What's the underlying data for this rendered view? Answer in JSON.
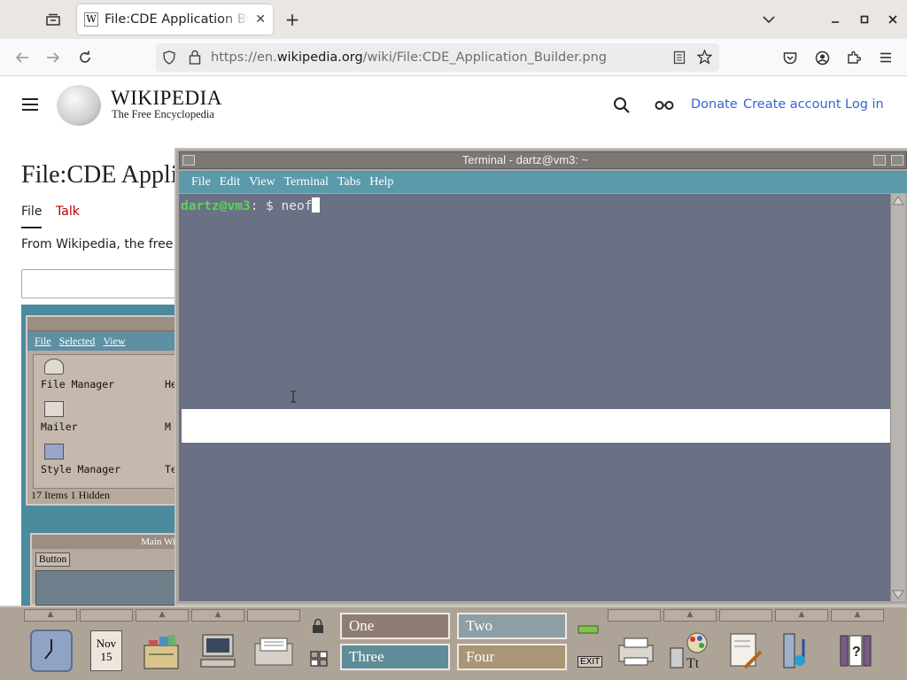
{
  "browser": {
    "tab_title": "File:CDE Application Builder.png",
    "tab_favicon": "W",
    "tab_close": "✕",
    "new_tab": "+",
    "url_prefix": "https://en.",
    "url_domain": "wikipedia.org",
    "url_path": "/wiki/File:CDE_Application_Builder.png"
  },
  "wikipedia": {
    "wordmark": "WIKIPEDIA",
    "tagline": "The Free Encyclopedia",
    "donate": "Donate",
    "create_account": "Create account",
    "log_in": "Log in",
    "page_title": "File:CDE Application Builder.png",
    "tab_file": "File",
    "tab_talk": "Talk",
    "from_text": "From Wikipedia, the free encyclopedia"
  },
  "cde_image": {
    "fm_menu": [
      "File",
      "Selected",
      "View"
    ],
    "fm_items": [
      "File Manager",
      "Mailer",
      "Style Manager"
    ],
    "fm_items_right": [
      "He",
      "M",
      "Te"
    ],
    "fm_status": "17 Items 1 Hidden",
    "main_window_title": "Main Wi",
    "main_button": "Button"
  },
  "terminal": {
    "title": "Terminal - dartz@vm3: ~",
    "menu": [
      "File",
      "Edit",
      "View",
      "Terminal",
      "Tabs",
      "Help"
    ],
    "prompt_user": "dartz@vm3",
    "prompt_rest": ": $ ",
    "command": "neof"
  },
  "panel": {
    "clock_month": "Nov",
    "clock_day": "15",
    "workspaces": [
      "One",
      "Two",
      "Three",
      "Four"
    ],
    "exit_label": "EXIT"
  },
  "colors": {
    "terminal_bg": "#6b7184",
    "terminal_menu": "#5a9aab",
    "prompt_user": "#5bd35b",
    "cde_panel": "#aea397",
    "workspace_one": "#8f7d73",
    "workspace_two": "#8d9ea4",
    "workspace_three": "#5e8c98",
    "workspace_four": "#a99675"
  }
}
